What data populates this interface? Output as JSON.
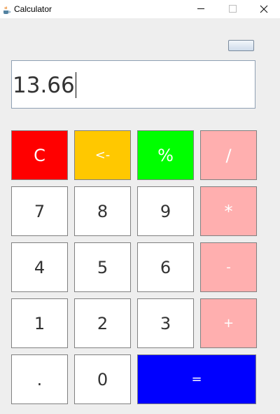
{
  "window": {
    "title": "Calculator",
    "icon": "java-coffee-cup-icon"
  },
  "display": {
    "value": "13.66"
  },
  "keypad": {
    "clear": "C",
    "backspace": "<-",
    "percent": "%",
    "divide": "/",
    "seven": "7",
    "eight": "8",
    "nine": "9",
    "multiply": "*",
    "four": "4",
    "five": "5",
    "six": "6",
    "subtract": "-",
    "one": "1",
    "two": "2",
    "three": "3",
    "add": "+",
    "decimal": ".",
    "zero": "0",
    "equals": "="
  },
  "colors": {
    "clear": "#ff0000",
    "backspace": "#ffc800",
    "percent": "#00ff00",
    "operator": "#ffafaf",
    "equals": "#0000ff",
    "digit": "#ffffff"
  }
}
